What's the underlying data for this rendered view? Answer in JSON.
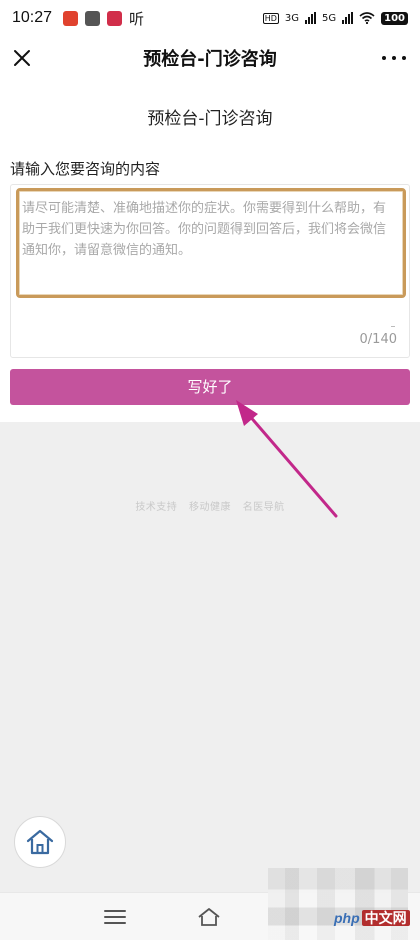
{
  "status_bar": {
    "time": "10:27",
    "notification_text": "听",
    "network_labels": [
      "3G",
      "5G"
    ],
    "battery": "100"
  },
  "nav": {
    "title": "预检台-门诊咨询",
    "close_icon": "close-icon",
    "more_icon": "more-icon"
  },
  "page": {
    "title": "预检台-门诊咨询",
    "section_label": "请输入您要咨询的内容",
    "textarea_placeholder": "请尽可能清楚、准确地描述你的症状。你需要得到什么帮助，有助于我们更快速为你回答。你的问题得到回答后，我们将会微信通知你，请留意微信的通知。",
    "char_count": "0/140",
    "submit_label": "写好了"
  },
  "footer": {
    "links": [
      "技术支持",
      "移动健康",
      "名医导航"
    ]
  },
  "bottom_bar": {
    "icons": [
      "menu-icon",
      "home-icon"
    ]
  },
  "watermark": {
    "text_a": "php",
    "text_b": "中文网"
  },
  "colors": {
    "accent": "#c4539d",
    "highlight_border": "#c99a5a",
    "annotation_arrow": "#c2288a"
  }
}
